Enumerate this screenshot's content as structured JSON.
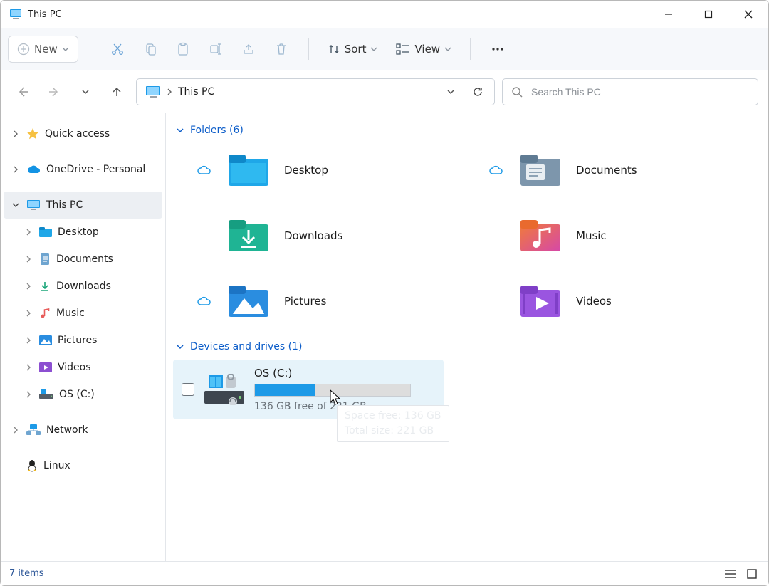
{
  "window": {
    "title": "This PC"
  },
  "toolbar": {
    "new_label": "New",
    "sort_label": "Sort",
    "view_label": "View"
  },
  "address": {
    "crumbs": [
      "This PC"
    ]
  },
  "search": {
    "placeholder": "Search This PC"
  },
  "nav": {
    "quick_access": "Quick access",
    "onedrive": "OneDrive - Personal",
    "this_pc": "This PC",
    "desktop": "Desktop",
    "documents": "Documents",
    "downloads": "Downloads",
    "music": "Music",
    "pictures": "Pictures",
    "videos": "Videos",
    "os_c": "OS (C:)",
    "network": "Network",
    "linux": "Linux"
  },
  "content": {
    "folders_header": "Folders (6)",
    "drives_header": "Devices and drives (1)",
    "folders": {
      "desktop": "Desktop",
      "documents": "Documents",
      "downloads": "Downloads",
      "music": "Music",
      "pictures": "Pictures",
      "videos": "Videos"
    },
    "drive": {
      "title": "OS (C:)",
      "free_line": "136 GB free of 221 GB",
      "bar_percent_used": 39
    },
    "tooltip": {
      "space_free": "Space free: 136 GB",
      "total_size": "Total size: 221 GB"
    }
  },
  "status": {
    "items": "7 items"
  }
}
